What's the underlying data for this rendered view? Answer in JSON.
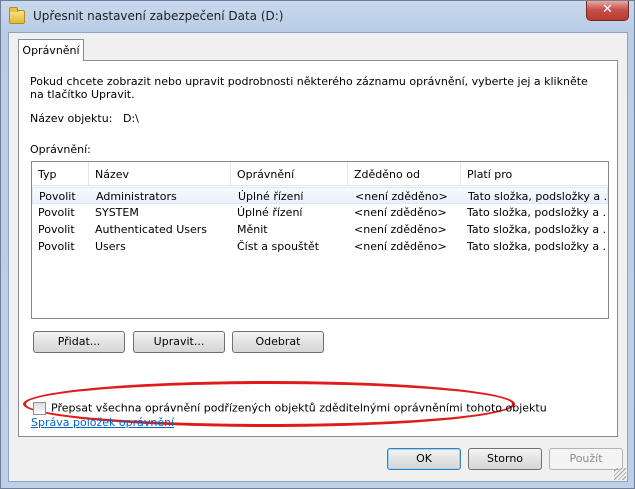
{
  "window": {
    "title": "Upřesnit nastavení zabezpečení Data (D:)",
    "close_glyph": "✕"
  },
  "tabs": [
    {
      "label": "Oprávnění"
    }
  ],
  "panel": {
    "description": "Pokud chcete zobrazit nebo upravit podrobnosti některého záznamu oprávnění, vyberte jej a klikněte na tlačítko Upravit.",
    "object_name_label": "Název objektu:",
    "object_name_value": "D:\\",
    "permissions_label": "Oprávnění:"
  },
  "table": {
    "columns": [
      "Typ",
      "Název",
      "Oprávnění",
      "Zděděno od",
      "Platí pro"
    ],
    "rows": [
      [
        "Povolit",
        "Administrators",
        "Úplné řízení",
        "<není zděděno>",
        "Tato složka, podsložky a ..."
      ],
      [
        "Povolit",
        "SYSTEM",
        "Úplné řízení",
        "<není zděděno>",
        "Tato složka, podsložky a ..."
      ],
      [
        "Povolit",
        "Authenticated Users",
        "Měnit",
        "<není zděděno>",
        "Tato složka, podsložky a ..."
      ],
      [
        "Povolit",
        "Users",
        "Číst a spouštět",
        "<není zděděno>",
        "Tato složka, podsložky a ..."
      ]
    ]
  },
  "buttons": {
    "add": "Přidat...",
    "edit": "Upravit...",
    "remove": "Odebrat",
    "ok": "OK",
    "cancel": "Storno",
    "apply": "Použít"
  },
  "checkbox": {
    "label": "Přepsat všechna oprávnění podřízených objektů zděditelnými oprávněními tohoto objektu",
    "checked": false
  },
  "link": {
    "label": "Správa položek oprávnění"
  },
  "colors": {
    "accent_link": "#0066cc",
    "highlight_ellipse": "#e01b1b"
  }
}
